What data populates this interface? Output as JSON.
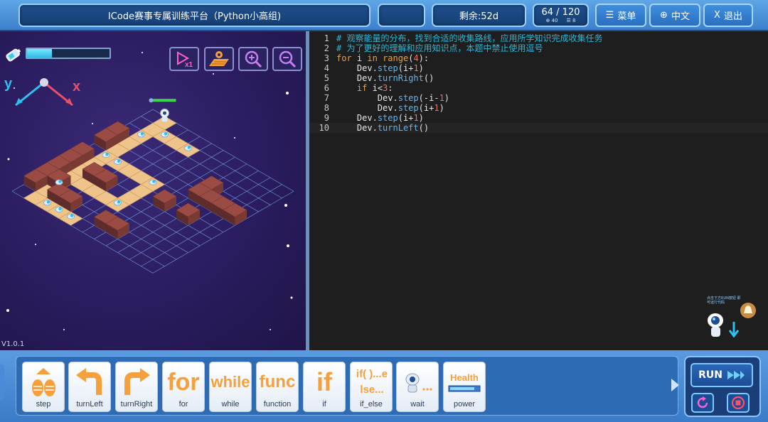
{
  "header": {
    "title": "ICode赛事专属训练平台（Python小高组)",
    "blank_label": "",
    "remaining": "剩余:52d",
    "progress": "64 / 120",
    "stat_a": "40",
    "stat_b": "8",
    "menu_label": "菜单",
    "lang_label": "中文",
    "exit_label": "退出"
  },
  "game": {
    "energy_fraction": 0.3,
    "axis_y": "y",
    "axis_x": "x",
    "version": "V1.0.1",
    "buttons": [
      {
        "name": "speed-x1-button",
        "icon": "speed-icon"
      },
      {
        "name": "map-button",
        "icon": "map-icon"
      },
      {
        "name": "zoom-in-button",
        "icon": "zoom-in-icon"
      },
      {
        "name": "zoom-out-button",
        "icon": "zoom-out-icon"
      }
    ]
  },
  "editor": {
    "lines": [
      {
        "n": "1",
        "text": "# 观察能量的分布，找到合适的收集路线，应用所学知识完成收集任务"
      },
      {
        "n": "2",
        "text": "# 为了更好的理解和应用知识点，本题中禁止使用逗号"
      },
      {
        "n": "3",
        "text": "for i in range(4):"
      },
      {
        "n": "4",
        "text": "    Dev.step(i+1)"
      },
      {
        "n": "5",
        "text": "    Dev.turnRight()"
      },
      {
        "n": "6",
        "text": "    if i<3:"
      },
      {
        "n": "7",
        "text": "        Dev.step(-i-1)"
      },
      {
        "n": "8",
        "text": "        Dev.step(i+1)"
      },
      {
        "n": "9",
        "text": "    Dev.step(i+1)"
      },
      {
        "n": "10",
        "text": "    Dev.turnLeft()"
      }
    ],
    "hint": "点击下方RUN按钮 即可运行代码"
  },
  "palette": {
    "blocks": [
      {
        "label": "step",
        "art": "step-icon"
      },
      {
        "label": "turnLeft",
        "art": "turn-left-icon"
      },
      {
        "label": "turnRight",
        "art": "turn-right-icon"
      },
      {
        "label": "for",
        "art": "for"
      },
      {
        "label": "while",
        "art": "while"
      },
      {
        "label": "function",
        "art": "func"
      },
      {
        "label": "if",
        "art": "if"
      },
      {
        "label": "if_else",
        "art": "if( )...else..."
      },
      {
        "label": "wait",
        "art": "wait-icon"
      },
      {
        "label": "power",
        "art": "Health"
      }
    ],
    "run_label": "RUN"
  },
  "colors": {
    "accent": "#3e8ee0",
    "orange": "#f5a03a",
    "comment": "#2fb6d6",
    "keyword": "#e8a33b"
  }
}
